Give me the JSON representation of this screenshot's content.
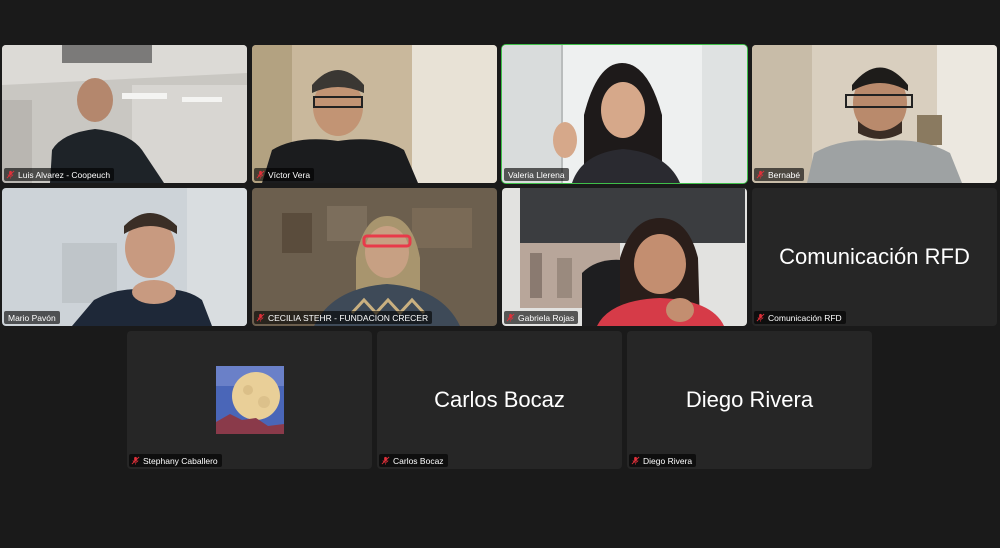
{
  "participants": [
    {
      "name": "Luis Alvarez - Coopeuch",
      "muted": true
    },
    {
      "name": "Víctor Vera",
      "muted": true
    },
    {
      "name": "Valeria Llerena",
      "muted": false,
      "speaking": true
    },
    {
      "name": "Bernabé",
      "muted": true
    },
    {
      "name": "Mario Pavón",
      "muted": false
    },
    {
      "name": "CECILIA STEHR - FUNDACION CRECER",
      "muted": true
    },
    {
      "name": "Gabriela Rojas",
      "muted": true
    },
    {
      "name": "Comunicación RFD",
      "muted": true,
      "display_name": "Comunicación RFD"
    },
    {
      "name": "Stephany Caballero",
      "muted": true
    },
    {
      "name": "Carlos Bocaz",
      "muted": true,
      "display_name": "Carlos Bocaz"
    },
    {
      "name": "Diego Rivera",
      "muted": true,
      "display_name": "Diego Rivera"
    }
  ],
  "colors": {
    "background": "#1a1a1a",
    "tile": "#262626",
    "active_speaker": "#3fbf4a",
    "mute_icon": "#e0303a"
  }
}
